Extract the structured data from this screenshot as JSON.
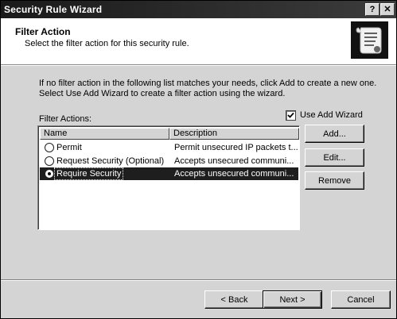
{
  "window": {
    "title": "Security Rule Wizard"
  },
  "titlebar_buttons": {
    "help": "?",
    "close": "✕"
  },
  "header": {
    "title": "Filter Action",
    "subtitle": "Select the filter action for this security rule.",
    "icon": "scroll-document-icon"
  },
  "intro": {
    "line1": "If no filter action in the following list matches your needs, click Add to create a new one.",
    "line2": "Select Use Add Wizard to create a filter action using the wizard."
  },
  "filter_actions_label": "Filter Actions:",
  "use_add_wizard": {
    "label": "Use Add Wizard",
    "checked": true
  },
  "list": {
    "columns": [
      "Name",
      "Description"
    ],
    "rows": [
      {
        "name": "Permit",
        "description": "Permit unsecured IP packets t...",
        "selected": false
      },
      {
        "name": "Request Security (Optional)",
        "description": "Accepts unsecured communi...",
        "selected": false
      },
      {
        "name": "Require Security",
        "description": "Accepts unsecured communi...",
        "selected": true
      }
    ]
  },
  "side_buttons": {
    "add": "Add...",
    "edit": "Edit...",
    "remove": "Remove"
  },
  "footer": {
    "back": "< Back",
    "next": "Next >",
    "cancel": "Cancel"
  }
}
